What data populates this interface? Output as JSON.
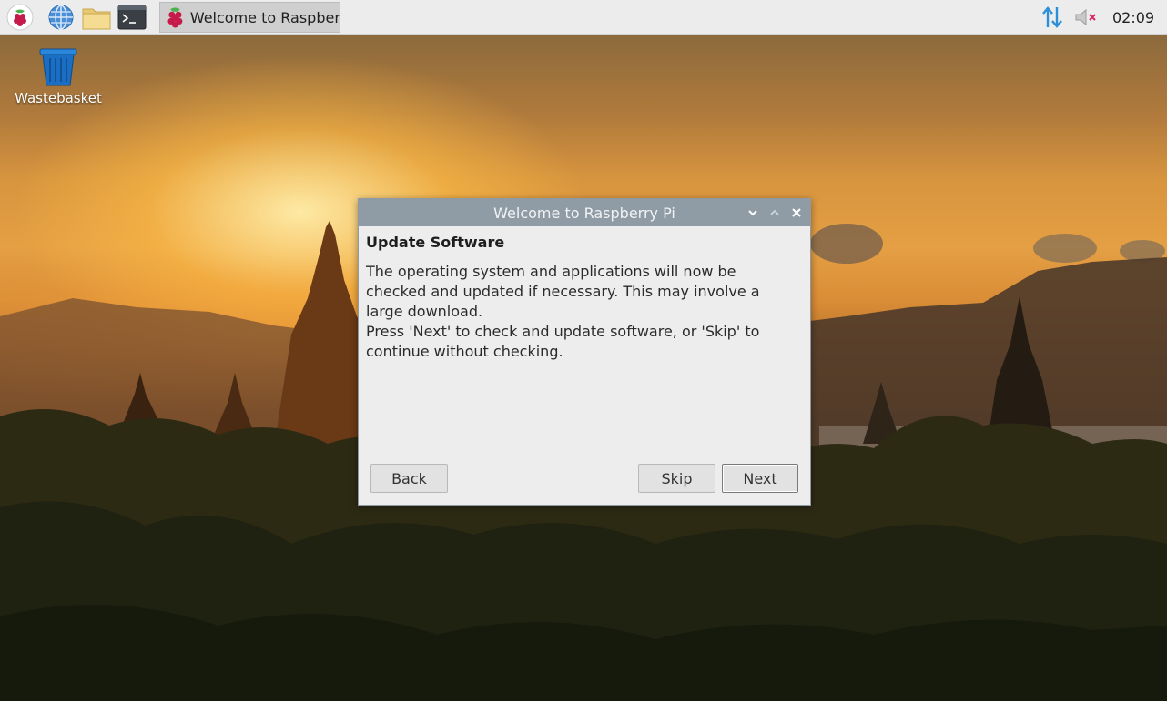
{
  "taskbar": {
    "launchers": [
      {
        "name": "raspberry-menu",
        "icon": "raspberry-icon"
      },
      {
        "name": "web-browser",
        "icon": "globe-icon"
      },
      {
        "name": "file-manager",
        "icon": "folder-icon"
      },
      {
        "name": "terminal",
        "icon": "terminal-icon"
      }
    ],
    "task_label": "Welcome to Raspberr...",
    "clock": "02:09",
    "tray": {
      "network_icon": "network-arrows-icon",
      "volume_icon": "volume-muted-icon"
    },
    "network_color": "#2a8fd8"
  },
  "desktop": {
    "icons": [
      {
        "label": "Wastebasket",
        "icon": "trash-icon",
        "color": "#1a6fc4"
      }
    ]
  },
  "dialog": {
    "title": "Welcome to Raspberry Pi",
    "heading": "Update Software",
    "paragraph1": "The operating system and applications will now be checked and updated if necessary. This may involve a large download.",
    "paragraph2": "Press 'Next' to check and update software, or 'Skip' to continue without checking.",
    "buttons": {
      "back": "Back",
      "skip": "Skip",
      "next": "Next"
    }
  }
}
